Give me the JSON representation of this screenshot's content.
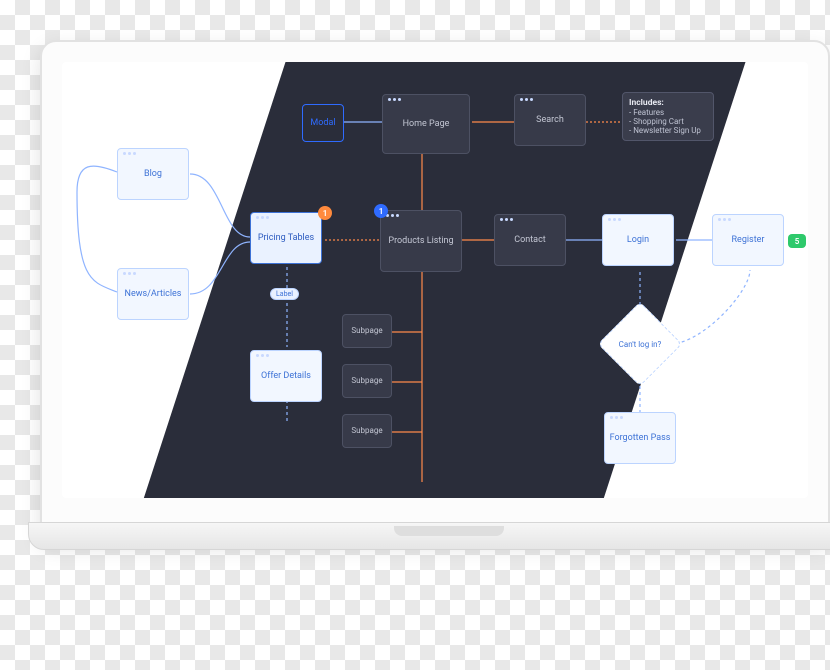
{
  "nodes": {
    "modal": "Modal",
    "home": "Home Page",
    "search": "Search",
    "blog": "Blog",
    "news": "News/Articles",
    "pricing": "Pricing Tables",
    "offer": "Offer Details",
    "products": "Products Listing",
    "contact": "Contact",
    "login": "Login",
    "register": "Register",
    "forgot": "Forgotten Pass",
    "sub1": "Subpage",
    "sub2": "Subpage",
    "sub3": "Subpage"
  },
  "labels": {
    "label_pill": "Label",
    "decision": "Can't log in?"
  },
  "badges": {
    "pricing": "1",
    "products": "1",
    "register": "5"
  },
  "note": {
    "title": "Includes:",
    "items": [
      "- Features",
      "- Shopping Cart",
      "- Newsletter Sign Up"
    ]
  }
}
